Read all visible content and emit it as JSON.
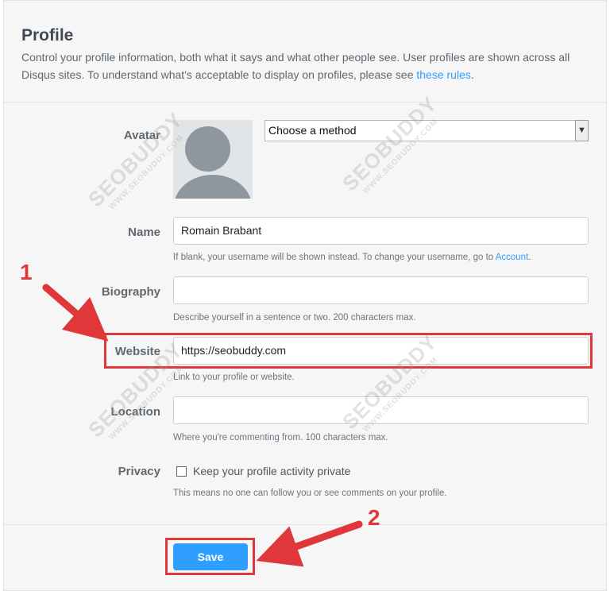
{
  "profile": {
    "title": "Profile",
    "intro_text": "Control your profile information, both what it says and what other people see. User profiles are shown across all Disqus sites. To understand what's acceptable to display on profiles, please see ",
    "intro_link": "these rules",
    "intro_end": "."
  },
  "form": {
    "avatar_label": "Avatar",
    "avatar_select_value": "Choose a method",
    "name_label": "Name",
    "name_value": "Romain Brabant",
    "name_help": "If blank, your username will be shown instead. To change your username, go to ",
    "name_help_link": "Account",
    "name_help_end": ".",
    "biography_label": "Biography",
    "biography_value": "",
    "biography_help": "Describe yourself in a sentence or two. 200 characters max.",
    "website_label": "Website",
    "website_value": "https://seobuddy.com",
    "website_help": "Link to your profile or website.",
    "location_label": "Location",
    "location_value": "",
    "location_help": "Where you're commenting from. 100 characters max.",
    "privacy_label": "Privacy",
    "privacy_checkbox_label": "Keep your profile activity private",
    "privacy_checked": false,
    "privacy_help": "This means no one can follow you or see comments on your profile.",
    "save_label": "Save"
  },
  "annotations": {
    "step1": "1",
    "step2": "2",
    "color": "#e0373a"
  },
  "watermark": {
    "brand": "SEOBUDDY",
    "url": "WWW.SEOBUDDY.COM"
  },
  "colors": {
    "accent": "#2e9fff",
    "label": "#606870"
  }
}
